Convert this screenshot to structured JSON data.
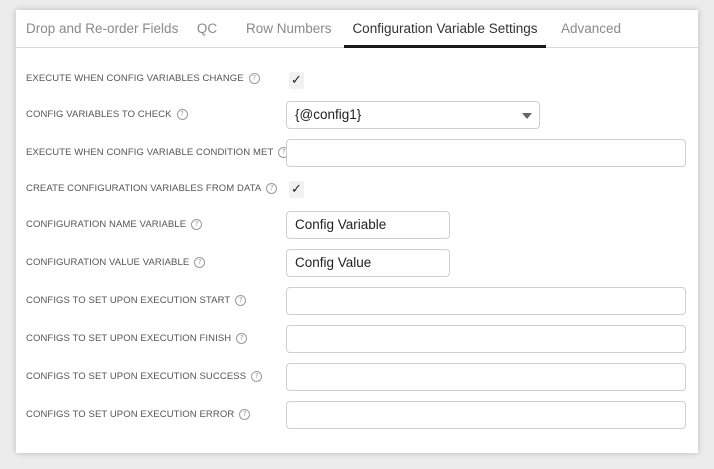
{
  "tabs": [
    {
      "label": "Drop and Re-order Fields"
    },
    {
      "label": "QC"
    },
    {
      "label": "Row Numbers"
    },
    {
      "label": "Configuration Variable Settings",
      "active": true
    },
    {
      "label": "Advanced"
    }
  ],
  "fields": {
    "execute_when_change": {
      "label": "EXECUTE WHEN CONFIG VARIABLES CHANGE",
      "checked": true
    },
    "vars_to_check": {
      "label": "CONFIG VARIABLES TO CHECK",
      "value": "{@config1}"
    },
    "execute_condition_met": {
      "label": "EXECUTE WHEN CONFIG VARIABLE CONDITION MET",
      "value": ""
    },
    "create_from_data": {
      "label": "CREATE CONFIGURATION VARIABLES FROM DATA",
      "checked": true
    },
    "name_variable": {
      "label": "CONFIGURATION NAME VARIABLE",
      "value": "Config Variable"
    },
    "value_variable": {
      "label": "CONFIGURATION VALUE VARIABLE",
      "value": "Config Value"
    },
    "exec_start": {
      "label": "CONFIGS TO SET UPON EXECUTION START",
      "value": ""
    },
    "exec_finish": {
      "label": "CONFIGS TO SET UPON EXECUTION FINISH",
      "value": ""
    },
    "exec_success": {
      "label": "CONFIGS TO SET UPON EXECUTION SUCCESS",
      "value": ""
    },
    "exec_error": {
      "label": "CONFIGS TO SET UPON EXECUTION ERROR",
      "value": ""
    }
  },
  "icons": {
    "help": "help-circle-icon",
    "check": "checkmark-icon",
    "caret": "caret-down-icon"
  },
  "glyphs": {
    "help": "?",
    "check": "✓"
  }
}
